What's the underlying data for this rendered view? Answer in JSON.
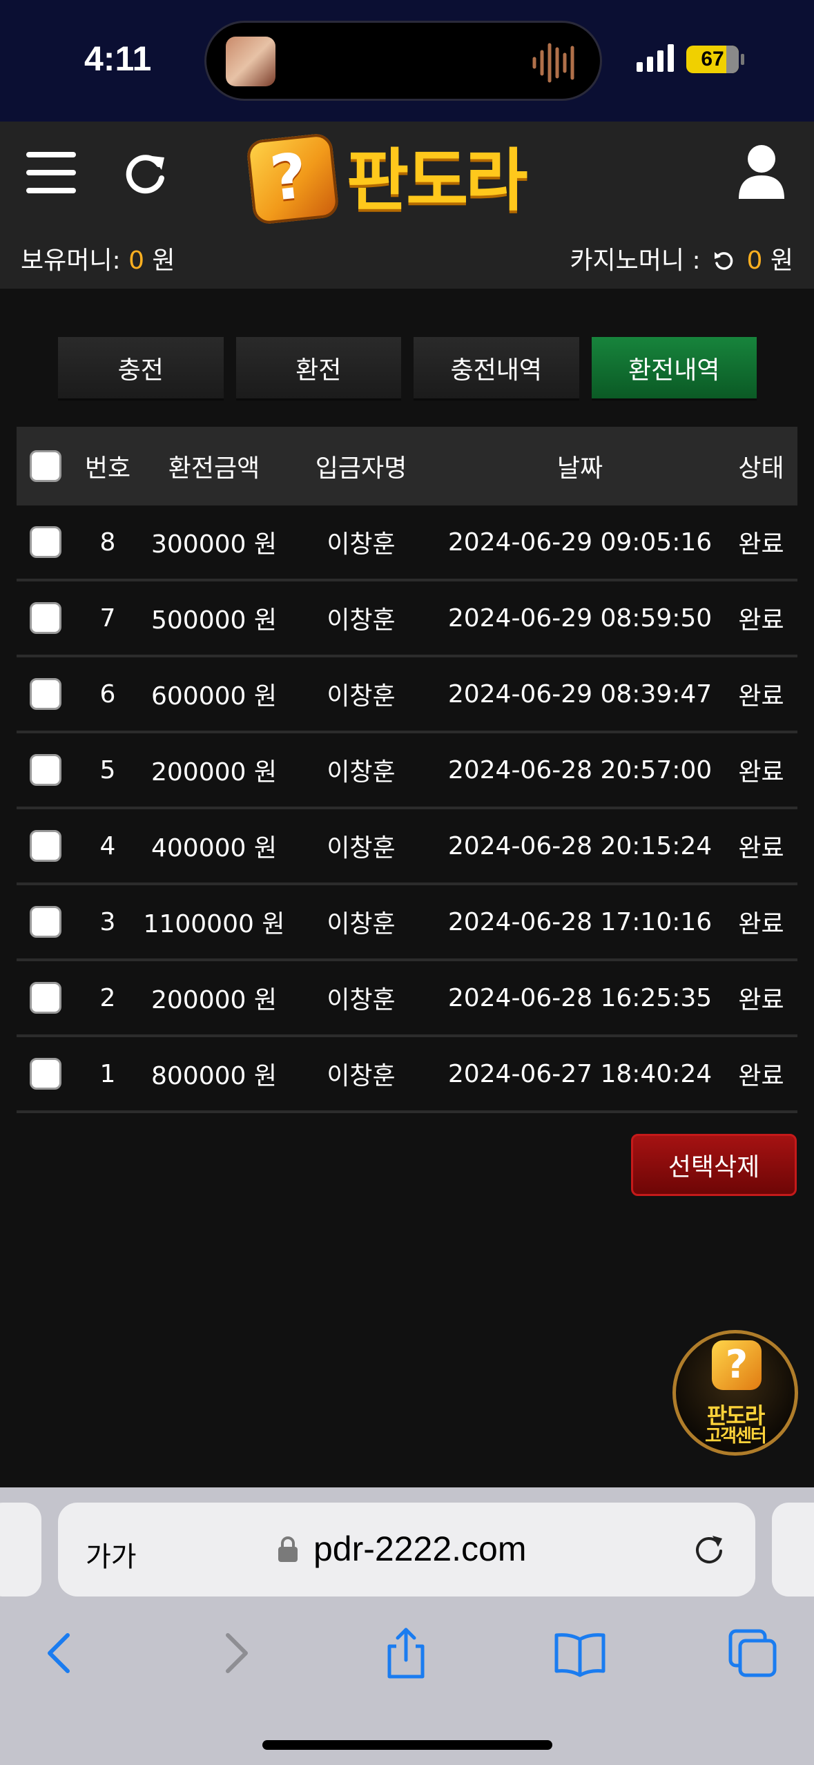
{
  "status_bar": {
    "time": "4:11",
    "battery": "67"
  },
  "header": {
    "logo_text": "판도라",
    "logo_symbol": "?",
    "balance_label": "보유머니:",
    "balance_value": "0",
    "balance_unit": "원",
    "casino_label": "카지노머니 :",
    "casino_value": "0",
    "casino_unit": "원"
  },
  "tabs": [
    {
      "label": "충전",
      "active": false
    },
    {
      "label": "환전",
      "active": false
    },
    {
      "label": "충전내역",
      "active": false
    },
    {
      "label": "환전내역",
      "active": true
    }
  ],
  "table": {
    "columns": [
      "번호",
      "환전금액",
      "입금자명",
      "날짜",
      "상태"
    ],
    "rows": [
      {
        "no": "8",
        "amount": "300000 원",
        "name": "이창훈",
        "date": "2024-06-29 09:05:16",
        "status": "완료"
      },
      {
        "no": "7",
        "amount": "500000 원",
        "name": "이창훈",
        "date": "2024-06-29 08:59:50",
        "status": "완료"
      },
      {
        "no": "6",
        "amount": "600000 원",
        "name": "이창훈",
        "date": "2024-06-29 08:39:47",
        "status": "완료"
      },
      {
        "no": "5",
        "amount": "200000 원",
        "name": "이창훈",
        "date": "2024-06-28 20:57:00",
        "status": "완료"
      },
      {
        "no": "4",
        "amount": "400000 원",
        "name": "이창훈",
        "date": "2024-06-28 20:15:24",
        "status": "완료"
      },
      {
        "no": "3",
        "amount": "1100000 원",
        "name": "이창훈",
        "date": "2024-06-28 17:10:16",
        "status": "완료"
      },
      {
        "no": "2",
        "amount": "200000 원",
        "name": "이창훈",
        "date": "2024-06-28 16:25:35",
        "status": "완료"
      },
      {
        "no": "1",
        "amount": "800000 원",
        "name": "이창훈",
        "date": "2024-06-27 18:40:24",
        "status": "완료"
      }
    ]
  },
  "delete_button": "선택삭제",
  "support": {
    "line1": "판도라",
    "line2": "고객센터",
    "symbol": "?"
  },
  "browser": {
    "text_size": "가가",
    "url": "pdr-2222.com"
  },
  "colors": {
    "accent": "#ffb020",
    "active_tab": "#17843c",
    "delete": "#a51212"
  }
}
